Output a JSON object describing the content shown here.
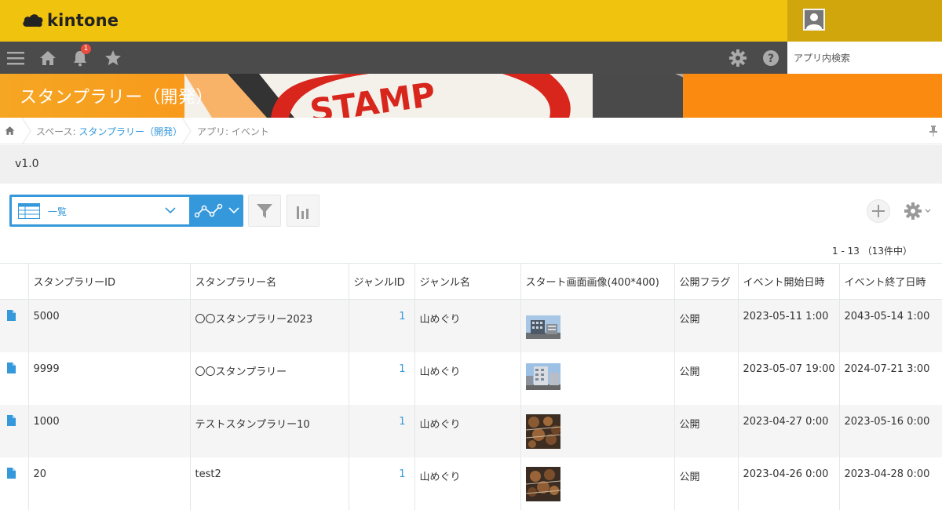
{
  "app": {
    "logo_text": "kintone"
  },
  "gnav": {
    "notification_count": "1",
    "search_placeholder": "アプリ内検索"
  },
  "space": {
    "title": "スタンプラリー（開発）"
  },
  "breadcrumb": {
    "space_prefix": "スペース: ",
    "space_name": "スタンプラリー（開発）",
    "app_label": "アプリ: イベント"
  },
  "version": "v1.0",
  "toolbar": {
    "view_name": "一覧"
  },
  "pager": {
    "text": "1 - 13 （13件中）"
  },
  "table": {
    "headers": [
      "スタンプラリーID",
      "スタンプラリー名",
      "ジャンルID",
      "ジャンル名",
      "スタート画面画像(400*400)",
      "公開フラグ",
      "イベント開始日時",
      "イベント終了日時"
    ],
    "rows": [
      {
        "id": "5000",
        "name": "〇〇スタンプラリー2023",
        "genre_id": "1",
        "genre_name": "山めぐり",
        "image": "building-photo",
        "flag": "公開",
        "start": "2023-05-11 1:00",
        "end": "2043-05-14 1:00"
      },
      {
        "id": "9999",
        "name": "〇〇スタンプラリー",
        "genre_id": "1",
        "genre_name": "山めぐり",
        "image": "building-photo",
        "flag": "公開",
        "start": "2023-05-07 19:00",
        "end": "2024-07-21 3:00"
      },
      {
        "id": "1000",
        "name": "テストスタンプラリー10",
        "genre_id": "1",
        "genre_name": "山めぐり",
        "image": "food-photo",
        "flag": "公開",
        "start": "2023-04-27 0:00",
        "end": "2023-05-16 0:00"
      },
      {
        "id": "20",
        "name": "test2",
        "genre_id": "1",
        "genre_name": "山めぐり",
        "image": "food-photo",
        "flag": "公開",
        "start": "2023-04-26 0:00",
        "end": "2023-04-28 0:00"
      }
    ]
  },
  "colors": {
    "topbar": "#f0c30f",
    "gnav": "#4b4b4b",
    "accent": "#3498db",
    "space_header": "#fb8a10"
  }
}
